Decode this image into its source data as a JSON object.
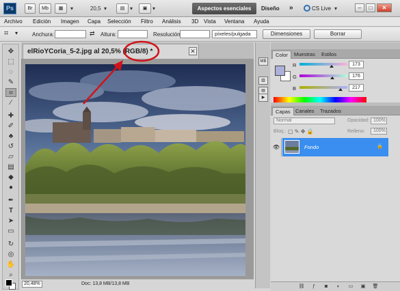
{
  "app": {
    "logo": "Ps",
    "bar_buttons": [
      "Br",
      "Mb"
    ],
    "zoom_value": "20,5",
    "workspace_active": "Aspectos esenciales",
    "workspace_other": "Diseño",
    "workspace_more": "»",
    "cs_live": "CS Live",
    "window_controls": [
      "–",
      "□",
      "✕"
    ]
  },
  "menu": [
    "Archivo",
    "Edición",
    "Imagen",
    "Capa",
    "Selección",
    "Filtro",
    "Análisis",
    "3D",
    "Vista",
    "Ventana",
    "Ayuda"
  ],
  "options": {
    "width_label": "Anchura:",
    "height_label": "Altura:",
    "resolution_label": "Resolución:",
    "unit_value": "píxeles/pulgada",
    "dimensions_button": "Dimensiones",
    "clear_button": "Borrar"
  },
  "document": {
    "title": "elRioYCoria_5-2.jpg al 20,5% (RGB/8) *",
    "close": "✕",
    "zoom": "20,48%",
    "info": "Doc: 13,8 MB/13,8 MB"
  },
  "color_panel": {
    "tabs": [
      "Color",
      "Muestras",
      "Estilos"
    ],
    "fg_color": "#adb0d9",
    "channels": [
      {
        "letter": "R",
        "value": "173",
        "level": 0.678
      },
      {
        "letter": "G",
        "value": "176",
        "level": 0.69
      },
      {
        "letter": "B",
        "value": "217",
        "level": 0.851
      }
    ]
  },
  "layers_panel": {
    "tabs": [
      "Capas",
      "Canales",
      "Trazados"
    ],
    "blend_mode": "Normal",
    "opacity_label": "Opacidad:",
    "opacity_value": "100%",
    "lock_label": "Bloq.:",
    "fill_label": "Relleno:",
    "fill_value": "100%",
    "layers": [
      {
        "name": "Fondo",
        "selected": true,
        "visible": true,
        "locked": true
      }
    ]
  },
  "colors": {
    "annotation_red": "#d0141a",
    "layer_selected": "#3a8ef0",
    "active_workspace": "#555555"
  }
}
